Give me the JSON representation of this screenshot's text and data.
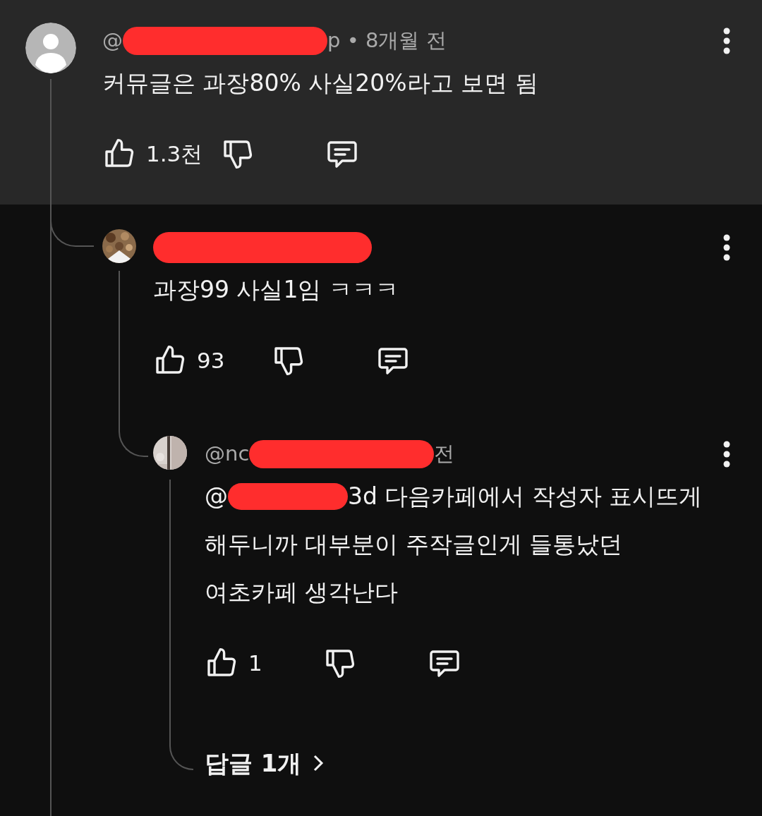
{
  "comments": [
    {
      "avatar": {
        "kind": "default"
      },
      "header_start": "@",
      "redacted": true,
      "header_end": "p • 8개월 전",
      "lines": [
        {
          "text": "커뮤글은 과장80% 사실20%라고 보면 됨"
        }
      ],
      "likes": "1.3천",
      "children": [
        {
          "redacted": true,
          "lines": [
            {
              "text": "과장99 사실1임 ㅋㅋㅋ"
            }
          ],
          "likes": "93",
          "children": [
            {
              "header_start": "@nc",
              "redacted": true,
              "header_end": "전",
              "lines": [
                {
                  "start": "@",
                  "redacted": true,
                  "text": "3d 다음카페에서 작성자 표시뜨게"
                },
                {
                  "text": "해두니까 대부분이 주작글인게 들통났던"
                },
                {
                  "text": "여초카페 생각난다"
                }
              ],
              "likes": "1",
              "replies_link": "답글 1개"
            }
          ]
        }
      ]
    }
  ]
}
